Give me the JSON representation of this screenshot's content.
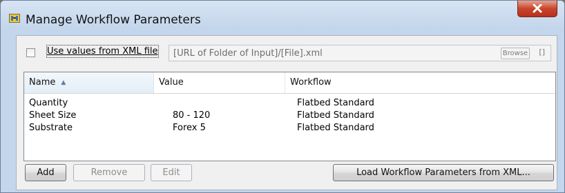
{
  "window": {
    "title": "Manage Workflow Parameters",
    "icon": "workflow-parameters-icon",
    "close_icon": "close-icon"
  },
  "xml": {
    "checkbox_label": "Use values from XML file",
    "checked": false,
    "url_value": "[URL of Folder of Input]/[File].xml",
    "browse_label": "Browse",
    "bracket_label": "[]"
  },
  "table": {
    "columns": [
      "Name",
      "Value",
      "Workflow"
    ],
    "sort_column": "Name",
    "sort_direction": "ascending",
    "rows": [
      {
        "name": "Quantity",
        "value": "",
        "workflow": "Flatbed Standard"
      },
      {
        "name": "Sheet Size",
        "value": "80 - 120",
        "workflow": "Flatbed Standard"
      },
      {
        "name": "Substrate",
        "value": "Forex 5",
        "workflow": "Flatbed Standard"
      }
    ]
  },
  "buttons": {
    "add": "Add",
    "remove": "Remove",
    "edit": "Edit",
    "load": "Load Workflow Parameters from XML..."
  },
  "colors": {
    "titlebar": "#c4d6ec",
    "close_button": "#c8452c",
    "sort_arrow": "#5b7fa8"
  }
}
